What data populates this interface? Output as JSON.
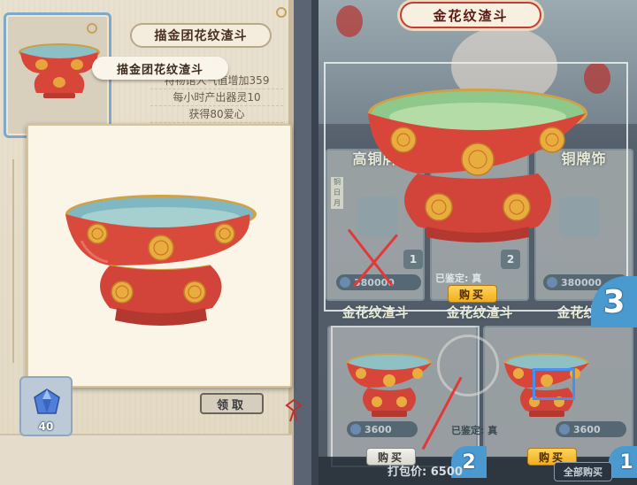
{
  "left": {
    "title": "描金团花纹渣斗",
    "name_tag": "描金团花纹渣斗",
    "desc_lines": [
      "特物馆人气值增加359",
      "每小时产出器灵10",
      "获得80爱心"
    ],
    "item_count": "40",
    "claim_label": "领取"
  },
  "right": {
    "banner": "金花纹渣斗",
    "top_cards": [
      {
        "title": "高铜牌",
        "price": "380000",
        "badge": "1"
      },
      {
        "title": "",
        "price": "",
        "badge": "2"
      },
      {
        "title": "铜牌饰",
        "price": "380000",
        "badge": ""
      }
    ],
    "mid_titles": [
      "金花纹渣斗",
      "金花纹渣斗",
      "金花纹"
    ],
    "bottom_cards": [
      {
        "price": "3600",
        "appraise": "",
        "buy_label": "购买",
        "step": "2"
      },
      {
        "price": "3600",
        "appraise": "已鉴定: 真",
        "buy_label": "购买",
        "step": "1"
      }
    ],
    "center_appraise": "已鉴定: 真",
    "center_buy_label": "购买",
    "big_step": "3",
    "mid_appraise": "已鉴定: 真",
    "pack_price_label": "打包价:",
    "pack_price_value": "6500",
    "all_buy_label": "全部购买",
    "date_tag": "铜 日月"
  },
  "colors": {
    "accent_red": "#c23e34",
    "buy_yellow": "#f7c23a",
    "step_blue": "#4a9ad0",
    "bowl_red": "#d8463a",
    "bowl_inner_blue": "#8cc0c4",
    "bowl_inner_green": "#9ccf90"
  }
}
